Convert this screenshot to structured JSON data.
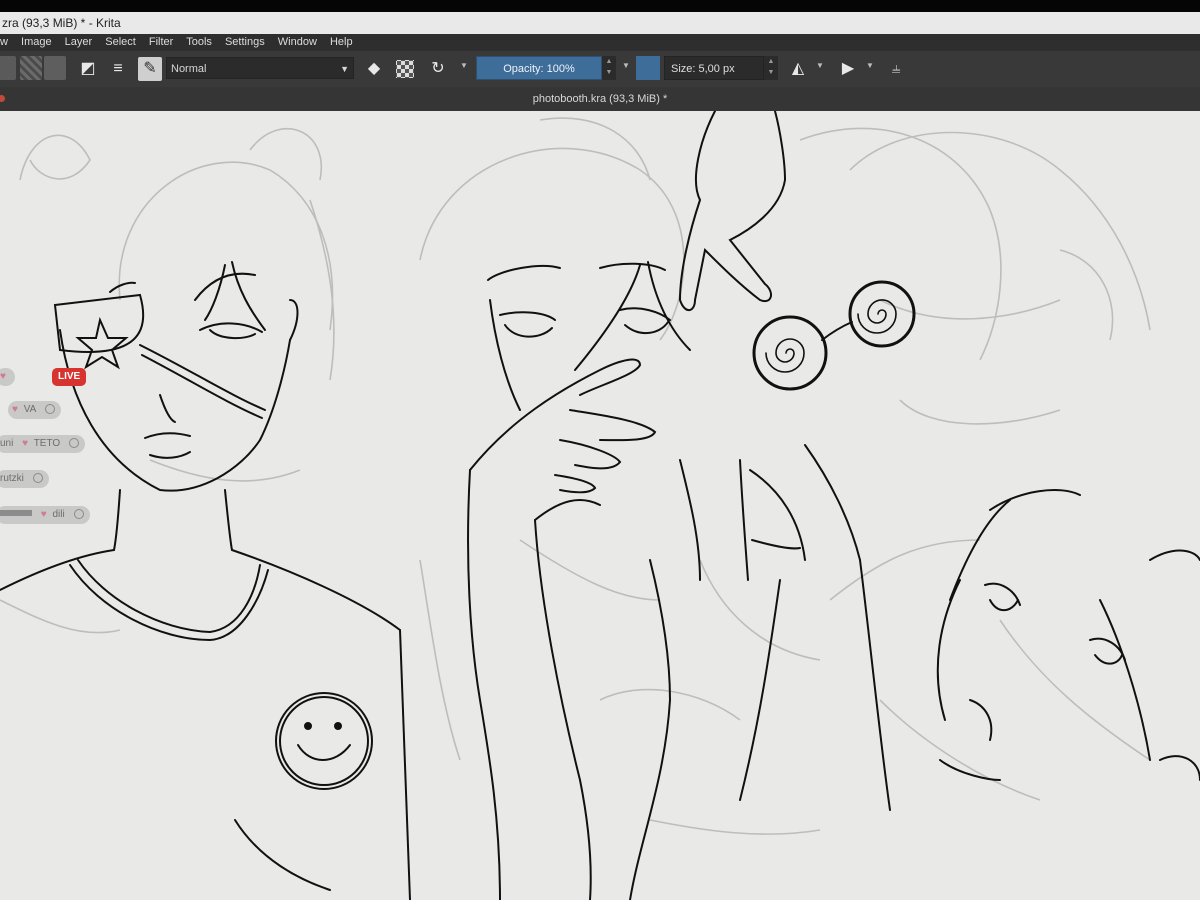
{
  "window": {
    "title": "zra (93,3 MiB) * - Krita"
  },
  "menu": [
    "w",
    "Image",
    "Layer",
    "Select",
    "Filter",
    "Tools",
    "Settings",
    "Window",
    "Help"
  ],
  "toolbar": {
    "blend_mode": "Normal",
    "opacity_label": "Opacity: 100%",
    "size_label": "Size: 5,00 px",
    "colors": {
      "accent": "#3e6d9a",
      "panel": "#393939",
      "menubar": "#2e2e2e"
    }
  },
  "document": {
    "tab_title": "photobooth.kra (93,3 MiB) *"
  },
  "stream_overlay": {
    "live_badge": "LIVE",
    "rows": [
      {
        "name": "",
        "tag": "",
        "has_icon": true
      },
      {
        "name": "",
        "tag": "VA",
        "has_icon": true
      },
      {
        "name": "uni",
        "tag": "TETO",
        "has_icon": true
      },
      {
        "name": "rutzki",
        "tag": "",
        "has_icon": true
      },
      {
        "name": "",
        "tag": "dili",
        "has_icon": true
      }
    ],
    "row_icon_name": "heart-icon"
  }
}
